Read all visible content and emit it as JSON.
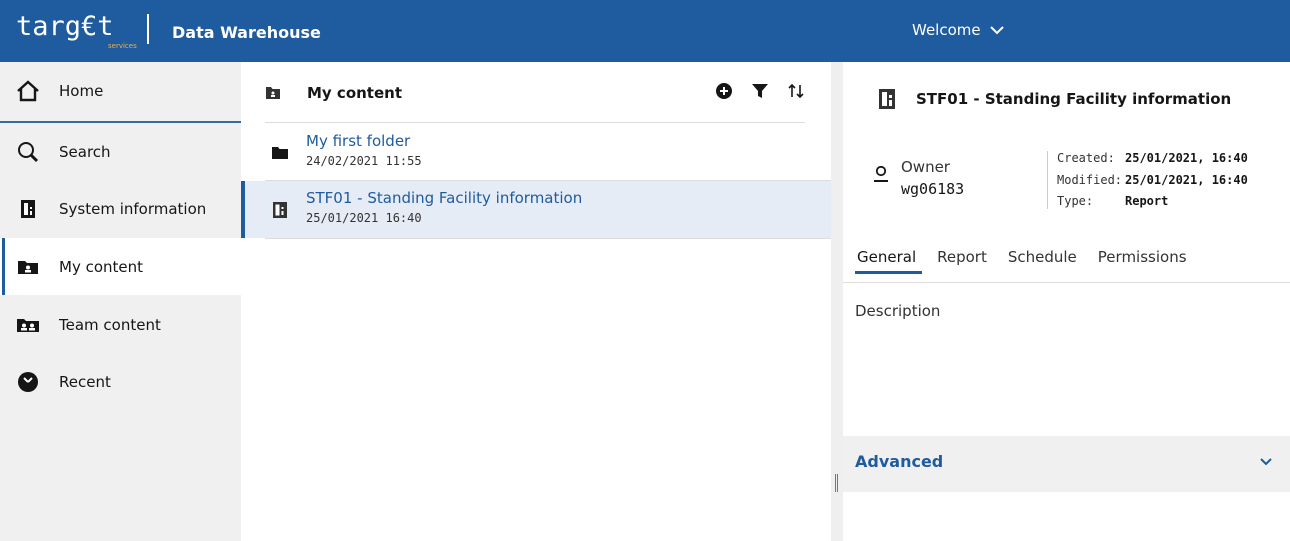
{
  "header": {
    "logo_text": "targ€t",
    "logo_sub": "services",
    "app_title": "Data Warehouse",
    "welcome_label": "Welcome",
    "brand_color": "#1f5b9f"
  },
  "sidebar": {
    "items": [
      {
        "label": "Home",
        "icon": "home-icon"
      },
      {
        "label": "Search",
        "icon": "search-icon"
      },
      {
        "label": "System information",
        "icon": "report-icon"
      },
      {
        "label": "My content",
        "icon": "my-content-folder-icon",
        "active": true
      },
      {
        "label": "Team content",
        "icon": "team-folder-icon"
      },
      {
        "label": "Recent",
        "icon": "clock-icon"
      }
    ]
  },
  "main": {
    "title": "My content",
    "tools": [
      "add-icon",
      "filter-icon",
      "sort-icon"
    ],
    "rows": [
      {
        "name": "My first folder",
        "date": "24/02/2021 11:55",
        "icon": "folder-icon"
      },
      {
        "name": "STF01 - Standing Facility information",
        "date": "25/01/2021 16:40",
        "icon": "report-icon",
        "selected": true
      }
    ]
  },
  "details": {
    "title": "STF01 - Standing Facility information",
    "owner_label": "Owner",
    "owner_value": "wg06183",
    "created_label": "Created:",
    "created_value": "25/01/2021, 16:40",
    "modified_label": "Modified:",
    "modified_value": "25/01/2021, 16:40",
    "type_label": "Type:",
    "type_value": "Report",
    "tabs": [
      "General",
      "Report",
      "Schedule",
      "Permissions"
    ],
    "active_tab": "General",
    "description_label": "Description",
    "advanced_label": "Advanced"
  }
}
